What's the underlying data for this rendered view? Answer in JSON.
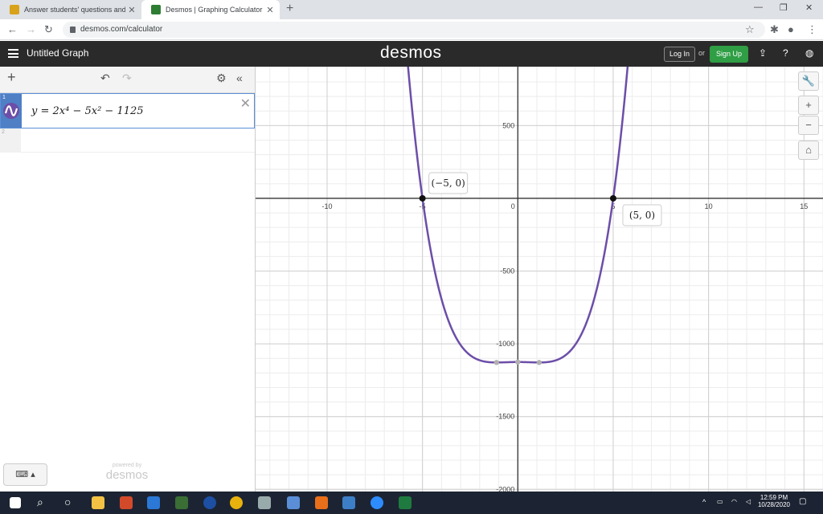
{
  "browser": {
    "tabs": [
      {
        "title": "Answer students' questions and",
        "favicon_color": "#d9a21b"
      },
      {
        "title": "Desmos | Graphing Calculator",
        "favicon_color": "#2e7d32"
      }
    ],
    "url": "desmos.com/calculator"
  },
  "header": {
    "graph_title": "Untitled Graph",
    "logo": "desmos",
    "login_label": "Log In",
    "or_label": "or",
    "signup_label": "Sign Up"
  },
  "expressions": {
    "items": [
      {
        "index": "1",
        "latex_text": "y = 2x⁴ − 5x² − 1125",
        "color": "#6c4ea8"
      },
      {
        "index": "2",
        "latex_text": ""
      }
    ],
    "powered_by": "powered by",
    "powered_logo": "desmos"
  },
  "chart_data": {
    "type": "line",
    "xlim": [
      -13.75,
      16.0
    ],
    "ylim": [
      -2015,
      905
    ],
    "x_ticks": [
      -10,
      -5,
      0,
      5,
      10,
      15
    ],
    "x_tick_labels": [
      "-10",
      "-5",
      "0",
      "5",
      "10",
      "15"
    ],
    "y_ticks": [
      -2000,
      -1500,
      -1000,
      -500,
      500
    ],
    "y_tick_labels": [
      "-2000",
      "-1500",
      "-1000",
      "-500",
      "500"
    ],
    "grid": true,
    "series": [
      {
        "expression": "2x^4 - 5x^2 - 1125",
        "color": "#6c4ea8"
      }
    ],
    "labeled_points": [
      {
        "x": -5,
        "y": 0,
        "label": "(−5, 0)"
      },
      {
        "x": 5,
        "y": 0,
        "label": "(5, 0)"
      }
    ],
    "gray_points": [
      {
        "x": -1.118,
        "y": -1128.125
      },
      {
        "x": 0,
        "y": -1125
      },
      {
        "x": 1.118,
        "y": -1128.125
      }
    ]
  },
  "taskbar": {
    "time": "12:59 PM",
    "date": "10/28/2020"
  }
}
